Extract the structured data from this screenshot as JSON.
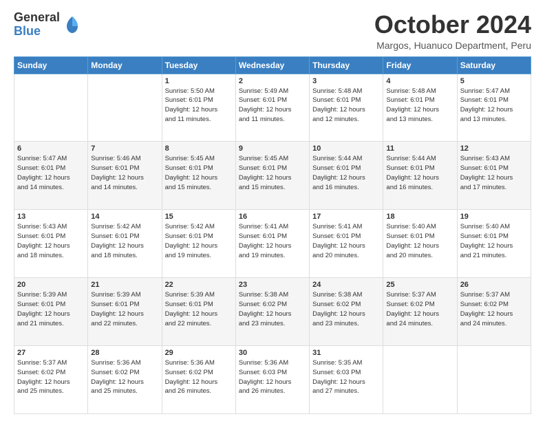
{
  "header": {
    "logo_line1": "General",
    "logo_line2": "Blue",
    "month_title": "October 2024",
    "subtitle": "Margos, Huanuco Department, Peru"
  },
  "weekdays": [
    "Sunday",
    "Monday",
    "Tuesday",
    "Wednesday",
    "Thursday",
    "Friday",
    "Saturday"
  ],
  "weeks": [
    [
      {
        "day": "",
        "info": ""
      },
      {
        "day": "",
        "info": ""
      },
      {
        "day": "1",
        "info": "Sunrise: 5:50 AM\nSunset: 6:01 PM\nDaylight: 12 hours\nand 11 minutes."
      },
      {
        "day": "2",
        "info": "Sunrise: 5:49 AM\nSunset: 6:01 PM\nDaylight: 12 hours\nand 11 minutes."
      },
      {
        "day": "3",
        "info": "Sunrise: 5:48 AM\nSunset: 6:01 PM\nDaylight: 12 hours\nand 12 minutes."
      },
      {
        "day": "4",
        "info": "Sunrise: 5:48 AM\nSunset: 6:01 PM\nDaylight: 12 hours\nand 13 minutes."
      },
      {
        "day": "5",
        "info": "Sunrise: 5:47 AM\nSunset: 6:01 PM\nDaylight: 12 hours\nand 13 minutes."
      }
    ],
    [
      {
        "day": "6",
        "info": "Sunrise: 5:47 AM\nSunset: 6:01 PM\nDaylight: 12 hours\nand 14 minutes."
      },
      {
        "day": "7",
        "info": "Sunrise: 5:46 AM\nSunset: 6:01 PM\nDaylight: 12 hours\nand 14 minutes."
      },
      {
        "day": "8",
        "info": "Sunrise: 5:45 AM\nSunset: 6:01 PM\nDaylight: 12 hours\nand 15 minutes."
      },
      {
        "day": "9",
        "info": "Sunrise: 5:45 AM\nSunset: 6:01 PM\nDaylight: 12 hours\nand 15 minutes."
      },
      {
        "day": "10",
        "info": "Sunrise: 5:44 AM\nSunset: 6:01 PM\nDaylight: 12 hours\nand 16 minutes."
      },
      {
        "day": "11",
        "info": "Sunrise: 5:44 AM\nSunset: 6:01 PM\nDaylight: 12 hours\nand 16 minutes."
      },
      {
        "day": "12",
        "info": "Sunrise: 5:43 AM\nSunset: 6:01 PM\nDaylight: 12 hours\nand 17 minutes."
      }
    ],
    [
      {
        "day": "13",
        "info": "Sunrise: 5:43 AM\nSunset: 6:01 PM\nDaylight: 12 hours\nand 18 minutes."
      },
      {
        "day": "14",
        "info": "Sunrise: 5:42 AM\nSunset: 6:01 PM\nDaylight: 12 hours\nand 18 minutes."
      },
      {
        "day": "15",
        "info": "Sunrise: 5:42 AM\nSunset: 6:01 PM\nDaylight: 12 hours\nand 19 minutes."
      },
      {
        "day": "16",
        "info": "Sunrise: 5:41 AM\nSunset: 6:01 PM\nDaylight: 12 hours\nand 19 minutes."
      },
      {
        "day": "17",
        "info": "Sunrise: 5:41 AM\nSunset: 6:01 PM\nDaylight: 12 hours\nand 20 minutes."
      },
      {
        "day": "18",
        "info": "Sunrise: 5:40 AM\nSunset: 6:01 PM\nDaylight: 12 hours\nand 20 minutes."
      },
      {
        "day": "19",
        "info": "Sunrise: 5:40 AM\nSunset: 6:01 PM\nDaylight: 12 hours\nand 21 minutes."
      }
    ],
    [
      {
        "day": "20",
        "info": "Sunrise: 5:39 AM\nSunset: 6:01 PM\nDaylight: 12 hours\nand 21 minutes."
      },
      {
        "day": "21",
        "info": "Sunrise: 5:39 AM\nSunset: 6:01 PM\nDaylight: 12 hours\nand 22 minutes."
      },
      {
        "day": "22",
        "info": "Sunrise: 5:39 AM\nSunset: 6:01 PM\nDaylight: 12 hours\nand 22 minutes."
      },
      {
        "day": "23",
        "info": "Sunrise: 5:38 AM\nSunset: 6:02 PM\nDaylight: 12 hours\nand 23 minutes."
      },
      {
        "day": "24",
        "info": "Sunrise: 5:38 AM\nSunset: 6:02 PM\nDaylight: 12 hours\nand 23 minutes."
      },
      {
        "day": "25",
        "info": "Sunrise: 5:37 AM\nSunset: 6:02 PM\nDaylight: 12 hours\nand 24 minutes."
      },
      {
        "day": "26",
        "info": "Sunrise: 5:37 AM\nSunset: 6:02 PM\nDaylight: 12 hours\nand 24 minutes."
      }
    ],
    [
      {
        "day": "27",
        "info": "Sunrise: 5:37 AM\nSunset: 6:02 PM\nDaylight: 12 hours\nand 25 minutes."
      },
      {
        "day": "28",
        "info": "Sunrise: 5:36 AM\nSunset: 6:02 PM\nDaylight: 12 hours\nand 25 minutes."
      },
      {
        "day": "29",
        "info": "Sunrise: 5:36 AM\nSunset: 6:02 PM\nDaylight: 12 hours\nand 26 minutes."
      },
      {
        "day": "30",
        "info": "Sunrise: 5:36 AM\nSunset: 6:03 PM\nDaylight: 12 hours\nand 26 minutes."
      },
      {
        "day": "31",
        "info": "Sunrise: 5:35 AM\nSunset: 6:03 PM\nDaylight: 12 hours\nand 27 minutes."
      },
      {
        "day": "",
        "info": ""
      },
      {
        "day": "",
        "info": ""
      }
    ]
  ]
}
